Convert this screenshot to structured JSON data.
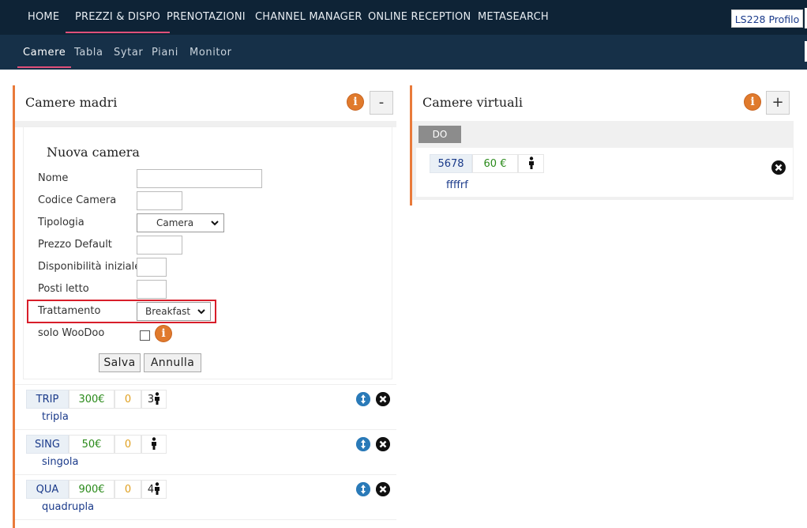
{
  "topnav": {
    "items": [
      "HOME",
      "PREZZI & DISPO",
      "PRENOTAZIONI",
      "CHANNEL MANAGER",
      "ONLINE RECEPTION",
      "METASEARCH"
    ],
    "profile": "LS228 Profilo"
  },
  "subnav": {
    "items": [
      "Camere",
      "Tabla",
      "Sytar",
      "Piani",
      "Monitor"
    ]
  },
  "left_panel": {
    "title": "Camere madri",
    "toggle": "-",
    "info": "i"
  },
  "form": {
    "title": "Nuova camera",
    "labels": {
      "nome": "Nome",
      "codice": "Codice Camera",
      "tipologia": "Tipologia",
      "prezzo": "Prezzo Default",
      "disp": "Disponibilità iniziale",
      "posti": "Posti letto",
      "trattamento": "Trattamento",
      "woodoo": "solo WooDoo"
    },
    "tipologia_value": "Camera",
    "trattamento_value": "Breakfast",
    "save": "Salva",
    "cancel": "Annulla"
  },
  "rooms": [
    {
      "code": "TRIP",
      "price": "300€",
      "zero": "0",
      "beds": "3",
      "name": "tripla"
    },
    {
      "code": "SING",
      "price": "50€",
      "zero": "0",
      "beds": "",
      "name": "singola"
    },
    {
      "code": "QUA",
      "price": "900€",
      "zero": "0",
      "beds": "4",
      "name": "quadrupla"
    }
  ],
  "right_panel": {
    "title": "Camere virtuali",
    "toggle": "+",
    "info": "i",
    "tag": "DO",
    "row": {
      "code": "5678",
      "price": "60 €",
      "name": "ffffrf"
    }
  },
  "colors": {
    "nav_bg": "#0e2336",
    "subnav_bg": "#163048",
    "accent": "#e97a3a",
    "active_underline": "#e0507a",
    "highlight": "#d81e2a"
  }
}
